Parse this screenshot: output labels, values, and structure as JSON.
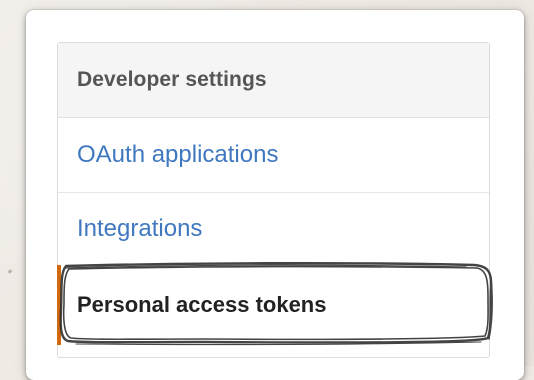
{
  "sidebar": {
    "heading": "Developer settings",
    "items": [
      {
        "label": "OAuth applications",
        "active": false
      },
      {
        "label": "Integrations",
        "active": false
      },
      {
        "label": "Personal access tokens",
        "active": true
      }
    ]
  },
  "colors": {
    "link": "#4078c0",
    "active_text": "#222222",
    "heading_text": "#555555",
    "active_indicator": "#d26911",
    "highlight_stroke": "#2b2b2b"
  }
}
